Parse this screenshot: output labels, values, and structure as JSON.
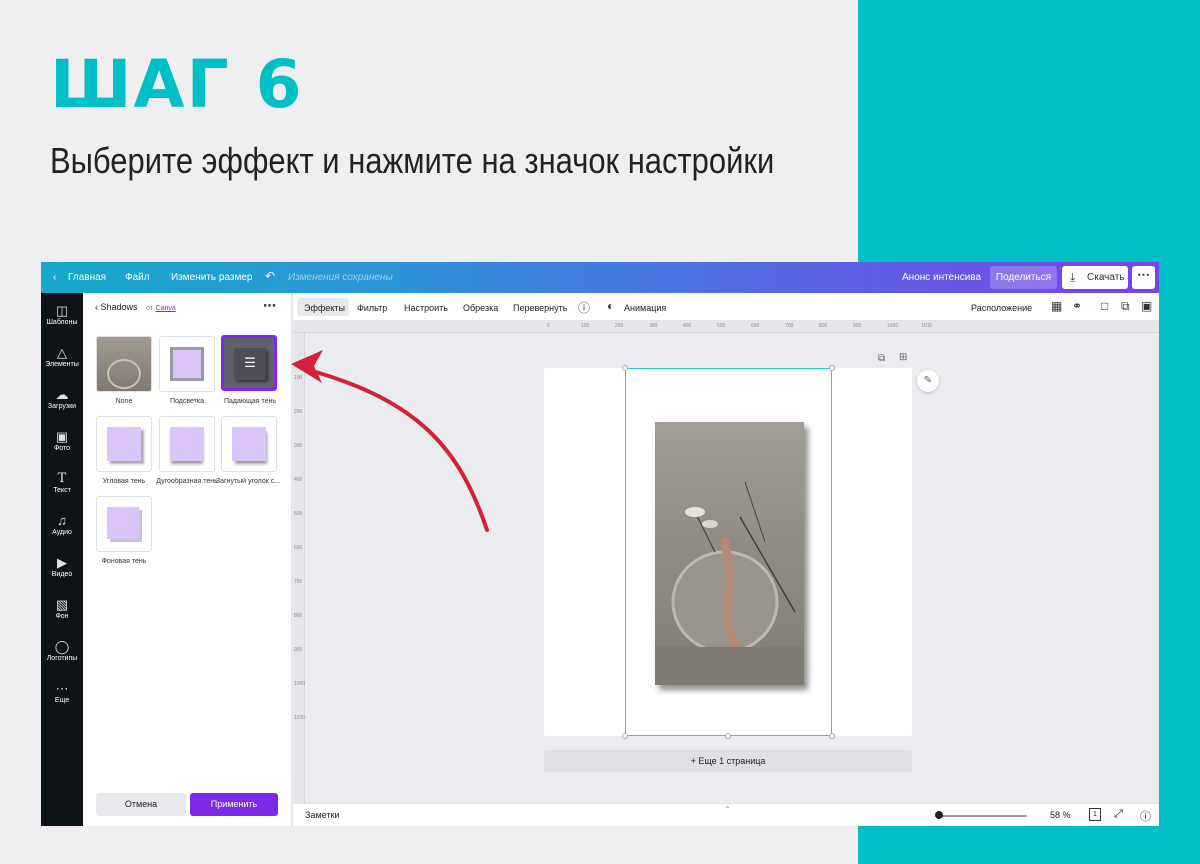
{
  "slide": {
    "title": "ШАГ 6",
    "subtitle": "Выберите эффект и нажмите на значок настройки"
  },
  "topbar": {
    "home": "Главная",
    "file": "Файл",
    "resize": "Изменить размер",
    "saved": "Изменения сохранены",
    "project": "Анонс интенсива",
    "share": "Поделиться",
    "download": "Скачать"
  },
  "rail": {
    "items": [
      {
        "label": "Шаблоны",
        "icon": "layout-icon"
      },
      {
        "label": "Элементы",
        "icon": "shapes-icon"
      },
      {
        "label": "Загрузки",
        "icon": "cloud-upload-icon"
      },
      {
        "label": "Фото",
        "icon": "image-icon"
      },
      {
        "label": "Текст",
        "icon": "text-icon"
      },
      {
        "label": "Аудио",
        "icon": "music-note-icon"
      },
      {
        "label": "Видео",
        "icon": "play-icon"
      },
      {
        "label": "Фон",
        "icon": "pattern-icon"
      },
      {
        "label": "Логотипы",
        "icon": "logo-icon"
      },
      {
        "label": "Еще",
        "icon": "more-dots-icon"
      }
    ]
  },
  "panel": {
    "title": "Shadows",
    "from": "от",
    "source": "Canva",
    "effects": [
      {
        "label": "None"
      },
      {
        "label": "Подсветка"
      },
      {
        "label": "Падающая тень"
      },
      {
        "label": "Угловая тень"
      },
      {
        "label": "Дугообразная тень"
      },
      {
        "label": "Загнутый уголок с..."
      },
      {
        "label": "Фоновая тень"
      }
    ],
    "cancel": "Отмена",
    "apply": "Применить"
  },
  "toolbar": {
    "effects": "Эффекты",
    "filter": "Фильтр",
    "adjust": "Настроить",
    "crop": "Обрезка",
    "flip": "Перевернуть",
    "animation": "Анимация",
    "position": "Расположение"
  },
  "ruler": {
    "top": [
      "0",
      "100",
      "200",
      "300",
      "400",
      "500",
      "600",
      "700",
      "800",
      "900",
      "1000",
      "1100"
    ],
    "left": [
      "100",
      "200",
      "300",
      "400",
      "500",
      "600",
      "700",
      "800",
      "900",
      "1000",
      "1100"
    ]
  },
  "canvas": {
    "add_page": "+ Еще 1 страница"
  },
  "bottombar": {
    "notes": "Заметки",
    "zoom": "58 %",
    "page_number": "1"
  },
  "colors": {
    "teal": "#00bfc6",
    "purple": "#7d2ae8",
    "arrow": "#d5203a"
  }
}
